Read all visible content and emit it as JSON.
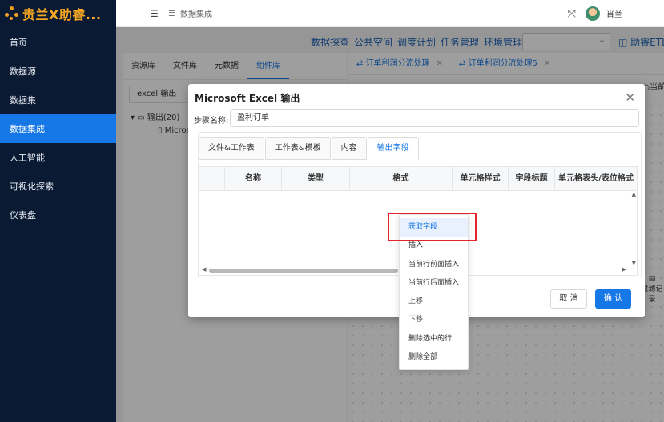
{
  "app": {
    "title": "贵兰X助睿...",
    "brand_color": "#f5a623"
  },
  "sidebar": {
    "items": [
      {
        "label": "首页"
      },
      {
        "label": "数据源"
      },
      {
        "label": "数据集"
      },
      {
        "label": "数据集成",
        "active": true
      },
      {
        "label": "人工智能"
      },
      {
        "label": "可视化探索"
      },
      {
        "label": "仪表盘"
      }
    ]
  },
  "header": {
    "breadcrumb": "数据集成",
    "user": "肖兰"
  },
  "topmenu": {
    "items": [
      "数据探查",
      "公共空间",
      "调度计划",
      "任务管理",
      "环境管理"
    ],
    "helper": "助睿ETL"
  },
  "left_panel": {
    "tabs": [
      "资源库",
      "文件库",
      "元数据",
      "组件库"
    ],
    "active_tab": "组件库",
    "search": "excel 输出",
    "tree_parent": "输出(20)",
    "tree_child": "Micros"
  },
  "right_panel": {
    "tabs": [
      "订单利润分流处理",
      "订单利润分流处理5"
    ],
    "current_label": "当前",
    "side_label": "过滤记录"
  },
  "dialog": {
    "title": "Microsoft Excel 输出",
    "step_label": "步骤名称:",
    "step_value": "盈利订单",
    "tabs": [
      "文件&工作表",
      "工作表&模板",
      "内容",
      "输出字段"
    ],
    "active_tab": "输出字段",
    "columns": [
      "",
      "名称",
      "类型",
      "格式",
      "单元格样式",
      "字段标题",
      "单元格表头/表位格式"
    ],
    "cancel": "取 消",
    "ok": "确 认"
  },
  "context_menu": {
    "items": [
      "获取字段",
      "插入",
      "当前行前面插入",
      "当前行后面插入",
      "上移",
      "下移",
      "删除选中的行",
      "删除全部"
    ],
    "highlighted": "获取字段"
  },
  "colors": {
    "primary": "#1677e6",
    "sidebar": "#0b1a33",
    "highlight_box": "#e0252b"
  }
}
